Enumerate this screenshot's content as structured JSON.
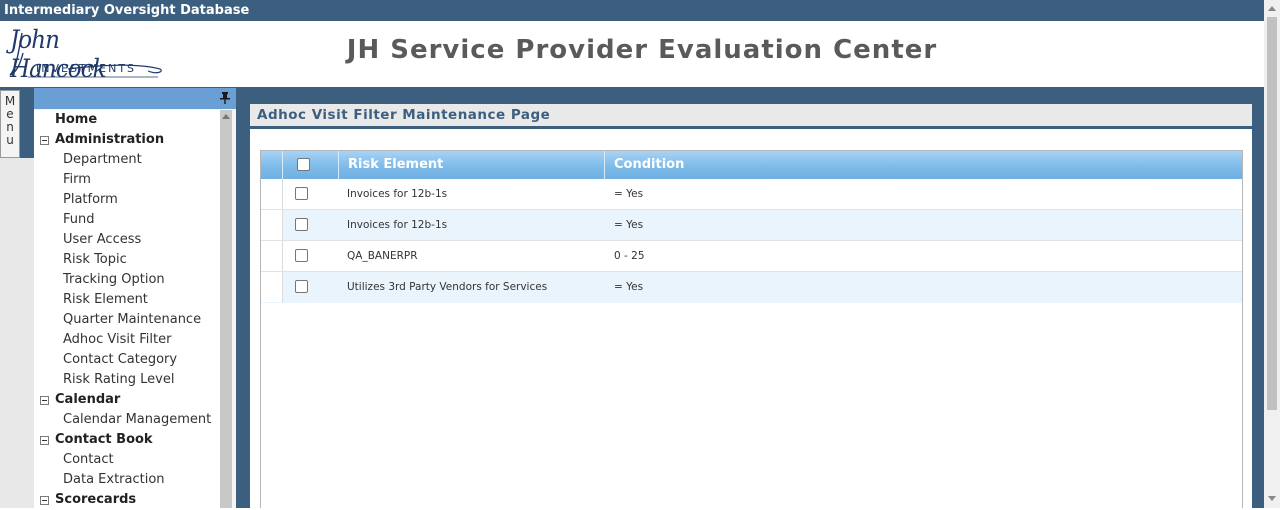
{
  "topbar": {
    "title": "Intermediary Oversight Database"
  },
  "header": {
    "logo_script": "John Hancock",
    "logo_sub": "INVESTMENTS",
    "app_title": "JH Service Provider Evaluation Center"
  },
  "menu_tab": {
    "letters": [
      "M",
      "e",
      "n",
      "u"
    ]
  },
  "sidebar": {
    "items": [
      {
        "label": "Home",
        "bold": true
      },
      {
        "label": "Administration",
        "bold": true,
        "collapsible": true
      },
      {
        "label": "Department"
      },
      {
        "label": "Firm"
      },
      {
        "label": "Platform"
      },
      {
        "label": "Fund"
      },
      {
        "label": "User Access"
      },
      {
        "label": "Risk Topic"
      },
      {
        "label": "Tracking Option"
      },
      {
        "label": "Risk Element"
      },
      {
        "label": "Quarter Maintenance"
      },
      {
        "label": "Adhoc Visit Filter"
      },
      {
        "label": "Contact Category"
      },
      {
        "label": "Risk Rating Level"
      },
      {
        "label": "Calendar",
        "bold": true,
        "collapsible": true
      },
      {
        "label": "Calendar Management"
      },
      {
        "label": "Contact Book",
        "bold": true,
        "collapsible": true
      },
      {
        "label": "Contact"
      },
      {
        "label": "Data Extraction"
      },
      {
        "label": "Scorecards",
        "bold": true,
        "collapsible": true
      }
    ]
  },
  "panel": {
    "title": "Adhoc Visit Filter Maintenance Page"
  },
  "grid": {
    "columns": {
      "risk_element": "Risk Element",
      "condition": "Condition"
    },
    "rows": [
      {
        "risk_element": "Invoices for 12b-1s",
        "condition": "= Yes"
      },
      {
        "risk_element": "Invoices for 12b-1s",
        "condition": "= Yes"
      },
      {
        "risk_element": "QA_BANERPR",
        "condition": "0 - 25"
      },
      {
        "risk_element": "Utilizes 3rd Party Vendors for Services",
        "condition": "= Yes"
      }
    ]
  },
  "colors": {
    "brand_bar": "#3d5f7f",
    "sidebar_head": "#6a9fd6",
    "grid_head": "#7ebbe9",
    "row_alt": "#eaf4fd",
    "logo_navy": "#1f3a68"
  }
}
